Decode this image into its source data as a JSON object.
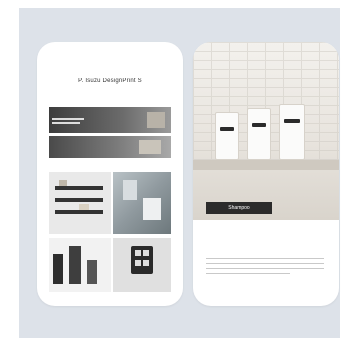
{
  "colors": {
    "backdrop": "#dde2e9",
    "phone": "#ffffff",
    "cta_bg": "#2b2b2b"
  },
  "left_screen": {
    "brand_title": "P. Isuzu DesignPrint S",
    "brand_subtitle": "",
    "section_1": "",
    "section_2": "",
    "tile_labels": [
      "",
      ""
    ]
  },
  "right_screen": {
    "cta_label": "Shampoo",
    "caption_title": "",
    "caption_lines": 4
  }
}
